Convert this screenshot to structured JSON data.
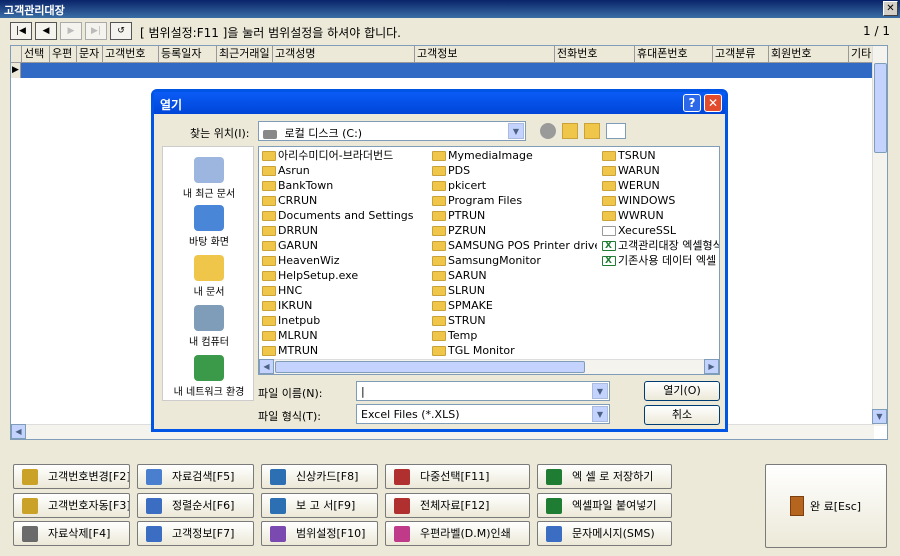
{
  "window": {
    "title": "고객관리대장",
    "close_glyph": "✕"
  },
  "toolbar": {
    "nav": [
      "|◀",
      "◀",
      "▶",
      "▶|",
      "↺"
    ],
    "hint": "[ 범위설정:F11 ]을 눌러 범위설정을 하셔야 합니다.",
    "pager": "1 / 1"
  },
  "grid": {
    "columns": [
      "선택",
      "우편",
      "문자",
      "고객번호",
      "등록일자",
      "최근거래일",
      "고객성명",
      "고객정보",
      "전화번호",
      "휴대폰번호",
      "고객분류",
      "회원번호",
      "기타"
    ],
    "row_indicator": "▶"
  },
  "dialog": {
    "title": "열기",
    "help_glyph": "?",
    "close_glyph": "✕",
    "lookin_label": "찾는 위치(I):",
    "lookin_value": "로컬 디스크 (C:)",
    "places": [
      "내 최근 문서",
      "바탕 화면",
      "내 문서",
      "내 컴퓨터",
      "내 네트워크 환경"
    ],
    "files": [
      {
        "name": "아리수미디어-브라더번드",
        "type": "folder"
      },
      {
        "name": "Asrun",
        "type": "folder"
      },
      {
        "name": "BankTown",
        "type": "folder"
      },
      {
        "name": "CRRUN",
        "type": "folder"
      },
      {
        "name": "Documents and Settings",
        "type": "folder"
      },
      {
        "name": "DRRUN",
        "type": "folder"
      },
      {
        "name": "GARUN",
        "type": "folder"
      },
      {
        "name": "HeavenWiz",
        "type": "folder"
      },
      {
        "name": "HelpSetup.exe",
        "type": "folder"
      },
      {
        "name": "HNC",
        "type": "folder"
      },
      {
        "name": "IKRUN",
        "type": "folder"
      },
      {
        "name": "Inetpub",
        "type": "folder"
      },
      {
        "name": "MLRUN",
        "type": "folder"
      },
      {
        "name": "MTRUN",
        "type": "folder"
      },
      {
        "name": "MymediaImage",
        "type": "folder"
      },
      {
        "name": "PDS",
        "type": "folder"
      },
      {
        "name": "pkicert",
        "type": "folder"
      },
      {
        "name": "Program Files",
        "type": "folder"
      },
      {
        "name": "PTRUN",
        "type": "folder"
      },
      {
        "name": "PZRUN",
        "type": "folder"
      },
      {
        "name": "SAMSUNG POS Printer driver",
        "type": "folder"
      },
      {
        "name": "SamsungMonitor",
        "type": "folder"
      },
      {
        "name": "SARUN",
        "type": "folder"
      },
      {
        "name": "SLRUN",
        "type": "folder"
      },
      {
        "name": "SPMAKE",
        "type": "folder"
      },
      {
        "name": "STRUN",
        "type": "folder"
      },
      {
        "name": "Temp",
        "type": "folder"
      },
      {
        "name": "TGL Monitor",
        "type": "folder"
      },
      {
        "name": "TSRUN",
        "type": "folder"
      },
      {
        "name": "WARUN",
        "type": "folder"
      },
      {
        "name": "WERUN",
        "type": "folder"
      },
      {
        "name": "WINDOWS",
        "type": "folder"
      },
      {
        "name": "WWRUN",
        "type": "folder"
      },
      {
        "name": "XecureSSL",
        "type": "folder-open"
      },
      {
        "name": "고객관리대장 엑셀형식",
        "type": "xls"
      },
      {
        "name": "기존사용 데이터 엑셀",
        "type": "xls"
      }
    ],
    "filename_label": "파일 이름(N):",
    "filename_value": "|",
    "filetype_label": "파일 형식(T):",
    "filetype_value": "Excel Files (*.XLS)",
    "open_button": "열기(O)",
    "cancel_button": "취소"
  },
  "buttons": [
    {
      "label": "고객번호변경[F2]",
      "icon": "key-icon",
      "color": "#c9a227"
    },
    {
      "label": "자료검색[F5]",
      "icon": "search-icon",
      "color": "#4a7fd0"
    },
    {
      "label": "신상카드[F8]",
      "icon": "printer-icon",
      "color": "#2c6fb3"
    },
    {
      "label": "다중선택[F11]",
      "icon": "checklist-icon",
      "color": "#b03030"
    },
    {
      "label": "엑 셀 로 저장하기",
      "icon": "excel-icon",
      "color": "#1e7d32"
    },
    {
      "label": "고객번호자동[F3]",
      "icon": "key-icon",
      "color": "#c9a227"
    },
    {
      "label": "정렬순서[F6]",
      "icon": "sort-icon",
      "color": "#3b6ec2"
    },
    {
      "label": "보 고 서[F9]",
      "icon": "printer-icon",
      "color": "#2c6fb3"
    },
    {
      "label": "전체자료[F12]",
      "icon": "checklist-icon",
      "color": "#b03030"
    },
    {
      "label": "엑셀파일 붙여넣기",
      "icon": "excel-icon",
      "color": "#1e7d32"
    },
    {
      "label": "자료삭제[F4]",
      "icon": "delete-icon",
      "color": "#6a6a6a"
    },
    {
      "label": "고객정보[F7]",
      "icon": "info-icon",
      "color": "#3b6ec2"
    },
    {
      "label": "범위설정[F10]",
      "icon": "range-icon",
      "color": "#7a4ab0"
    },
    {
      "label": "우편라벨(D.M)인쇄",
      "icon": "mail-icon",
      "color": "#c03a8a"
    },
    {
      "label": "문자메시지(SMS)",
      "icon": "sms-icon",
      "color": "#3b6ec2"
    }
  ],
  "exit_button": {
    "label": "완 료[Esc]",
    "color": "#c0392b"
  }
}
